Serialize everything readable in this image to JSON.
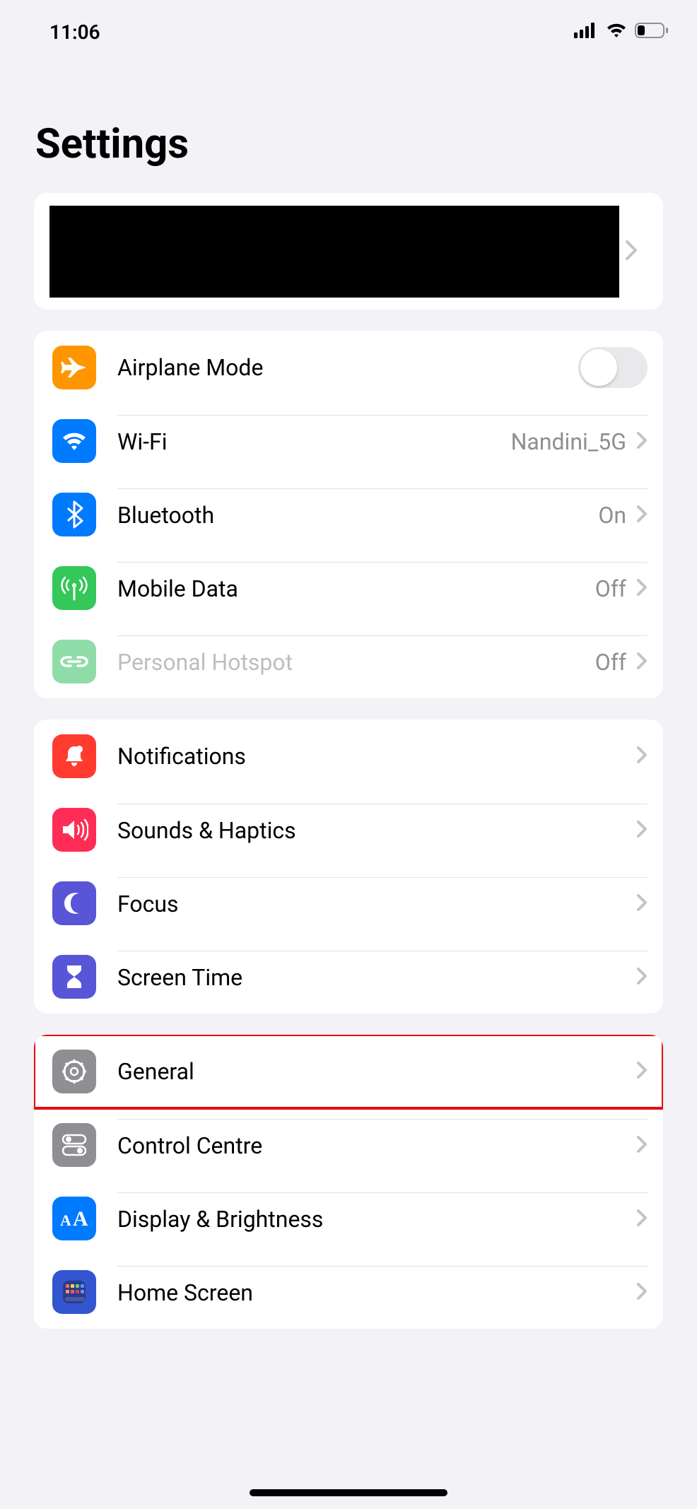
{
  "status": {
    "time": "11:06"
  },
  "page": {
    "title": "Settings"
  },
  "groups": {
    "connectivity": {
      "airplane": {
        "label": "Airplane Mode"
      },
      "wifi": {
        "label": "Wi-Fi",
        "value": "Nandini_5G"
      },
      "bluetooth": {
        "label": "Bluetooth",
        "value": "On"
      },
      "mobiledata": {
        "label": "Mobile Data",
        "value": "Off"
      },
      "hotspot": {
        "label": "Personal Hotspot",
        "value": "Off"
      }
    },
    "notifications": {
      "notifications": {
        "label": "Notifications"
      },
      "sounds": {
        "label": "Sounds & Haptics"
      },
      "focus": {
        "label": "Focus"
      },
      "screentime": {
        "label": "Screen Time"
      }
    },
    "general": {
      "general": {
        "label": "General"
      },
      "controlcentre": {
        "label": "Control Centre"
      },
      "display": {
        "label": "Display & Brightness"
      },
      "homescreen": {
        "label": "Home Screen"
      }
    }
  }
}
